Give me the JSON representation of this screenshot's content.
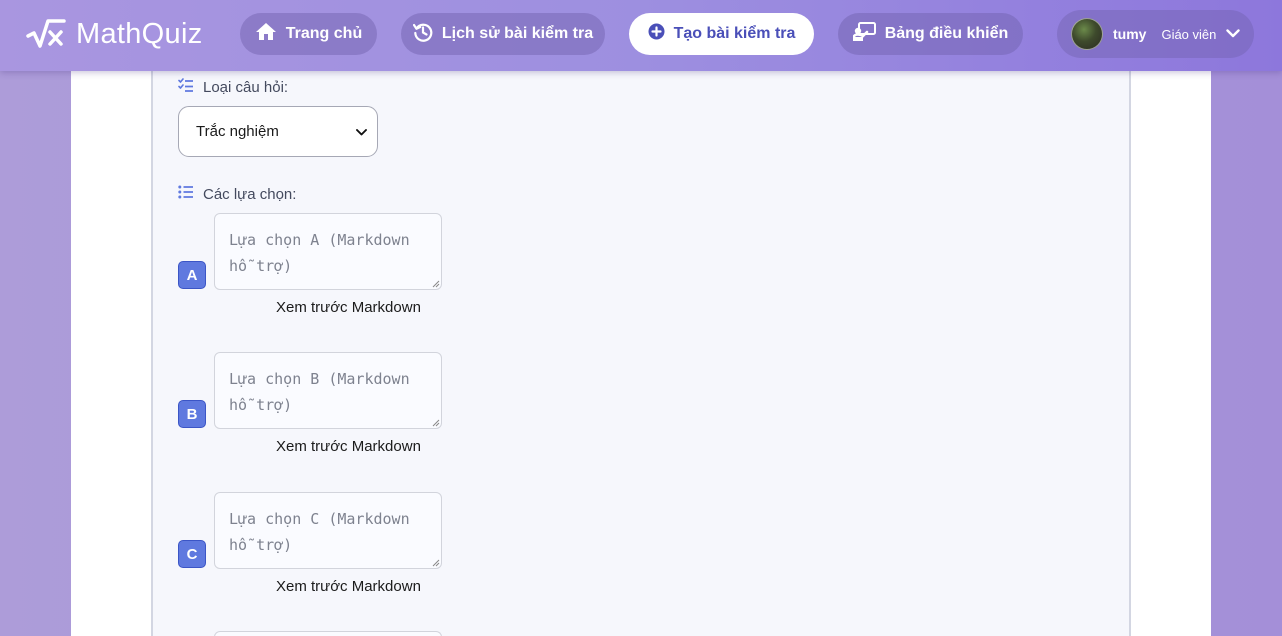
{
  "brand": {
    "name": "MathQuiz",
    "icon": "sqrt-x-icon"
  },
  "nav": {
    "home": {
      "label": "Trang chủ",
      "icon": "home-icon"
    },
    "history": {
      "label": "Lịch sử bài kiểm tra",
      "icon": "history-icon"
    },
    "create": {
      "label": "Tạo bài kiểm tra",
      "icon": "plus-circle-icon",
      "active": true
    },
    "dashboard": {
      "label": "Bảng điều khiển",
      "icon": "teacher-board-icon"
    }
  },
  "user": {
    "name": "tumy",
    "role": "Giáo viên",
    "icon": "chevron-down-icon"
  },
  "question": {
    "type_label": "Loại câu hỏi:",
    "type_value": "Trắc nghiệm",
    "choices_label": "Các lựa chọn:",
    "options": [
      {
        "letter": "A",
        "placeholder": "Lựa chọn A (Markdown hỗ trợ)",
        "preview": "Xem trước Markdown"
      },
      {
        "letter": "B",
        "placeholder": "Lựa chọn B (Markdown hỗ trợ)",
        "preview": "Xem trước Markdown"
      },
      {
        "letter": "C",
        "placeholder": "Lựa chọn C (Markdown hỗ trợ)",
        "preview": "Xem trước Markdown"
      }
    ]
  },
  "colors": {
    "header_start": "#a996e0",
    "header_end": "#8d77dc",
    "active_text": "#4a4fb8",
    "badge": "#5f79df",
    "panel_bg": "#f6f7fc"
  }
}
